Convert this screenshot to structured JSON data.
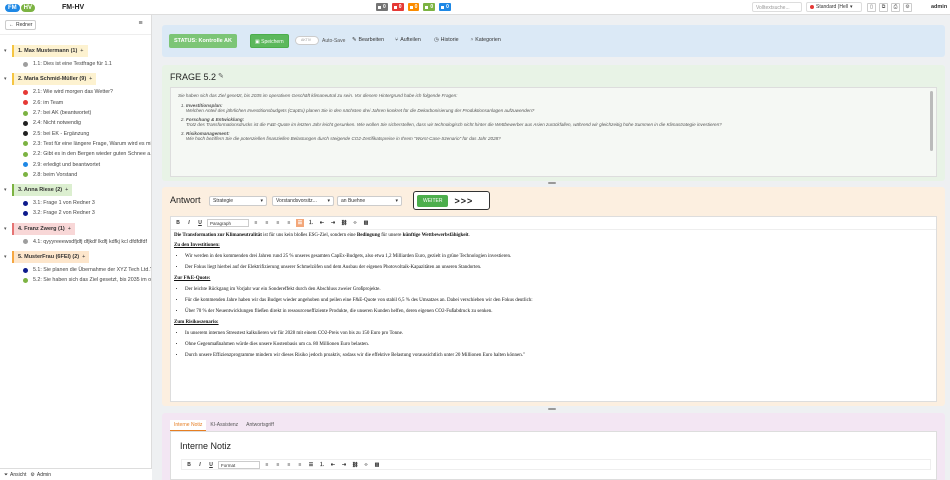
{
  "topbar": {
    "logo_fm": "FM",
    "logo_hv": "HV",
    "title": "FM-HV",
    "counters": [
      {
        "value": "0",
        "color": "#757575"
      },
      {
        "value": "0",
        "color": "#e53935"
      },
      {
        "value": "0",
        "color": "#fb8c00"
      },
      {
        "value": "0",
        "color": "#7cb342"
      },
      {
        "value": "0",
        "color": "#1e88e5"
      }
    ],
    "search_placeholder": "Volltextsuche...",
    "view_label": "Standard (Hell",
    "user": "admin"
  },
  "sidebar": {
    "back_label": "Redner",
    "groups": [
      {
        "label": "1. Max Mustermann (1)",
        "color": "#f5c542",
        "bg": "#fdf2d0",
        "items": [
          {
            "label": "1.1: Dies ist eine Testfrage für 1.1",
            "dot": "#9e9e9e"
          }
        ]
      },
      {
        "label": "2. Maria Schmid-Müller (9)",
        "color": "#f5c542",
        "bg": "#fdf2d0",
        "items": [
          {
            "label": "2.1: Wie wird morgen das Wetter?",
            "dot": "#e53935"
          },
          {
            "label": "2.6: im Team",
            "dot": "#e53935"
          },
          {
            "label": "2.7: bei AK (beantwortet)",
            "dot": "#7cb342"
          },
          {
            "label": "2.4: Nicht notwendig",
            "dot": "#212121"
          },
          {
            "label": "2.5: bei EK - Ergänzung",
            "dot": "#212121"
          },
          {
            "label": "2.3: Test für eine längere Frage, Warum wird es mi",
            "dot": "#7cb342"
          },
          {
            "label": "2.2: Gibt es in den Bergen wieder guten Schnee a...",
            "dot": "#7cb342"
          },
          {
            "label": "2.9: erledigt und beantwortet",
            "dot": "#1e88e5"
          },
          {
            "label": "2.8: beim Vorstand",
            "dot": "#7cb342"
          }
        ]
      },
      {
        "label": "3. Anna Riese (2)",
        "color": "#7cb342",
        "bg": "#dcefd0",
        "items": [
          {
            "label": "3.1: Frage 1 von Redner 3",
            "dot": "#0d1b8c"
          },
          {
            "label": "3.2: Frage 2 von Redner 3",
            "dot": "#0d1b8c"
          }
        ]
      },
      {
        "label": "4. Franz Zwerg (1)",
        "color": "#e57373",
        "bg": "#f8d7d7",
        "items": [
          {
            "label": "4.1: qyyyreeewsdfjdfj dfjkdf lkdfj kdfkj kcl dfdfdfdf",
            "dot": "#9e9e9e"
          }
        ]
      },
      {
        "label": "5. MusterFrau (6FEI) (2)",
        "color": "#f5a742",
        "bg": "#fde6cc",
        "items": [
          {
            "label": "5.1: Sie planen die Übernahme der XYZ Tech Ltd.?",
            "dot": "#0d1b8c"
          },
          {
            "label": "5.2: Sie haben sich das Ziel gesetzt, bis 2035 im op",
            "dot": "#7cb342"
          }
        ]
      }
    ],
    "bottom": {
      "view": "Ansicht",
      "admin": "Admin"
    }
  },
  "status": {
    "status_label": "STATUS: Kontrolle AK",
    "save": "Speichern",
    "toggle_text": "AKTIV",
    "autosave": "Auto-Save",
    "edit": "Bearbeiten",
    "split": "Aufteilen",
    "history": "Historie",
    "categories": "Kategorien"
  },
  "frage": {
    "title": "FRAGE 5.2",
    "intro": "Sie haben sich das Ziel gesetzt, bis 2035 im operativen Geschäft klimaneutral zu sein. Vor diesem Hintergrund habe ich folgende Fragen:",
    "points": [
      {
        "head": "Investitionsplan:",
        "text": "Welchen Anteil des jährlichen Investitionsbudgets (CapEx) planen Sie in den nächsten drei Jahren konkret für die Dekarbonisierung der Produktionsanlagen aufzuwenden?"
      },
      {
        "head": "Forschung & Entwicklung:",
        "text": "Trotz des Transformationsdrucks ist die F&E-Quote im letzten Jahr leicht gesunken. Wie wollen Sie sicherstellen, dass wir technologisch nicht hinter die Wettbewerber aus Asien zurückfallen, während wir gleichzeitig hohe Summen in die Klimastrategie investieren?"
      },
      {
        "head": "Risikomanagement:",
        "text": "Wie hoch beziffern Sie die potenziellen finanziellen Belastungen durch steigende CO2-Zertifikatspreise in Ihrem \"Worst-Case-Szenario\" für das Jahr 2028?"
      }
    ]
  },
  "antwort": {
    "title": "Antwort",
    "selects": [
      "Strategie",
      "Vorstandsvorsitz...",
      "an Buehne"
    ],
    "weiter": "WEITER",
    "arrows": ">>>",
    "paragraph_select": "Paragraph",
    "intro_bold1": "Die Transformation zur Klimaneutralität",
    "intro_mid": " ist für uns kein bloßes ESG-Ziel, sondern eine ",
    "intro_bold2": "Bedingung",
    "intro_mid2": " für unsere ",
    "intro_bold3": "künftige Wettbewerbsfähigkeit",
    "intro_end": ".",
    "sections": [
      {
        "head": "Zu den Investitionen:",
        "bullets": [
          "Wir werden in den kommenden drei Jahren rund 25 % unseres gesamten CapEx-Budgets, also etwa 1,2 Milliarden Euro, gezielt in grüne Technologien investieren.",
          "Der Fokus liegt hierbei auf der Elektrifizierung unserer Schmelzöfen und dem Ausbau der eigenen Photovoltaik-Kapazitäten an unseren Standorten."
        ]
      },
      {
        "head": "Zur F&E-Quote:",
        "bullets": [
          "Der leichte Rückgang im Vorjahr war ein Sondereffekt durch den Abschluss zweier Großprojekte.",
          "Für die kommenden Jahre haben wir das Budget wieder angehoben und peilen eine F&E-Quote von stabil 6,5 % des Umsatzes an. Dabei verschieben wir den Fokus deutlich:",
          "Über 70 % der Neuentwicklungen fließen direkt in ressourceneffiziente Produkte, die unseren Kunden helfen, deren eigenen CO2-Fußabdruck zu senken."
        ]
      },
      {
        "head": "Zum Risikoszenario:",
        "bullets": [
          "In unserem internen Stresstest kalkulieren wir für 2028 mit einem CO2-Preis von bis zu 150 Euro pro Tonne.",
          "Ohne Gegenmaßnahmen würde dies unsere Kostenbasis um ca. 80 Millionen Euro belasten.",
          "Durch unsere Effizienzprogramme mindern wir dieses Risiko jedoch proaktiv, sodass wir die effektive Belastung voraussichtlich unter 20 Millionen Euro halten können.\""
        ]
      }
    ]
  },
  "notiz": {
    "tabs": [
      "Interne Notiz",
      "KI-Assistenz",
      "Antwortsgriff"
    ],
    "title": "Interne Notiz",
    "format_select": "Format"
  }
}
